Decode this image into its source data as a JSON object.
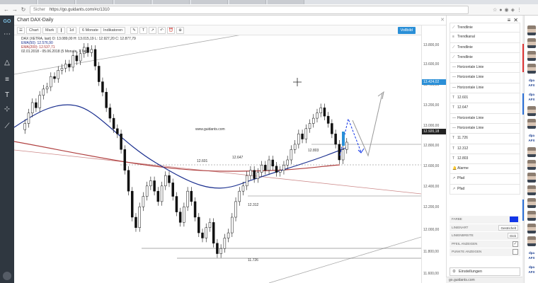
{
  "browser": {
    "tabs": [
      "Google Finance",
      "Ausbildungs...",
      "Godmode",
      "Anbieten...",
      "Produkte...",
      "Aktienfinder",
      "DAX index",
      "aktienfinder..."
    ],
    "secure_label": "Sicher",
    "url": "https://go.guidants.com/#c/1310"
  },
  "sidebar": {
    "logo": "GO",
    "tools": [
      "dot-dashed-line-icon",
      "triangle-icon",
      "channel-icon",
      "text-icon",
      "crosshair-icon",
      "line-icon"
    ]
  },
  "chart_window": {
    "title": "Chart DAX-Daily",
    "toolbar": {
      "chart_btn": "Chart",
      "mark_btn": "Mark",
      "timeframe": "1d",
      "range": "6 Monate",
      "indicators": "Indikatoren",
      "fullscreen": "Vollbild"
    },
    "legend": {
      "instrument": "DAX (XETRA, last) O: 13.089,00  H: 13.015,19  L: 12.927,20  C: 12.877,79",
      "ema50": "EMA(50): 12.576,90",
      "ema200": "EMA(200): 12.537,71",
      "period": "02.01.2018 - 05.06.2018  (5 Monate, 1 Tag)"
    },
    "watermark": "www.guidants.com",
    "annotations": {
      "level_12647": "12.647",
      "level_12601": "12.601",
      "level_12803": "12.803",
      "level_12312": "12.312",
      "level_11726": "11.726"
    },
    "price_axis": {
      "ticks": [
        "13.800,00",
        "13.600,00",
        "13.400,00",
        "13.200,00",
        "13.000,00",
        "12.800,00",
        "12.600,00",
        "12.400,00",
        "12.200,00",
        "12.000,00",
        "11.800,00",
        "11.600,00"
      ],
      "current_price": "12.920,18",
      "marker_price": "13.424,02"
    }
  },
  "right_panel": {
    "items": [
      {
        "icon": "line-icon",
        "label": "Trendlinie"
      },
      {
        "icon": "channel-icon",
        "label": "Trendkanal"
      },
      {
        "icon": "line-icon",
        "label": "Trendlinie"
      },
      {
        "icon": "line-icon",
        "label": "Trendlinie"
      },
      {
        "icon": "hline-icon",
        "label": "Horizontale Linie"
      },
      {
        "icon": "hline-icon",
        "label": "Horizontale Linie"
      },
      {
        "icon": "hline-icon",
        "label": "Horizontale Linie"
      },
      {
        "icon": "text-icon",
        "label": "12.601"
      },
      {
        "icon": "text-icon",
        "label": "12.647"
      },
      {
        "icon": "hline-icon",
        "label": "Horizontale Linie"
      },
      {
        "icon": "hline-icon",
        "label": "Horizontale Linie"
      },
      {
        "icon": "text-icon",
        "label": "11.726"
      },
      {
        "icon": "text-icon",
        "label": "12.312"
      },
      {
        "icon": "text-icon",
        "label": "12.803"
      },
      {
        "icon": "bell-icon",
        "label": "Alarme"
      },
      {
        "icon": "arrow-icon",
        "label": "Pfad"
      },
      {
        "icon": "arrow-icon",
        "label": "Pfad"
      }
    ],
    "properties": {
      "color_label": "FARBE",
      "color_value": "#1236e8",
      "linetype_label": "LINIENART",
      "linetype_value": "Gestrichelt",
      "linewidth_label": "LINIENBREITE",
      "linewidth_value": "Dick",
      "arrow_label": "PFEIL ANZEIGEN",
      "arrow_checked": "✓",
      "points_label": "PUNKTE ANZEIGEN",
      "points_checked": ""
    },
    "settings_label": "Einstellungen",
    "footer": "go.guidants.com"
  },
  "colors": {
    "candle_up": "#ffffff",
    "candle_down": "#111111",
    "ema50": "#1a2f8f",
    "ema200": "#b04040",
    "accent": "#2a8fd7",
    "path_blue": "#1236e8"
  }
}
